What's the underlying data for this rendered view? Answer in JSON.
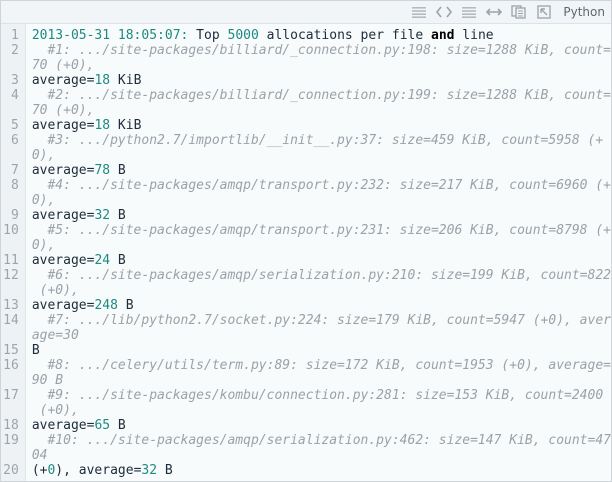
{
  "toolbar": {
    "icons": [
      "view-source-icon",
      "expand-icon",
      "copy-icon",
      "print-icon",
      "popout-icon"
    ],
    "language": "Python"
  },
  "code": {
    "line_numbers": [
      "1",
      "2",
      "3",
      "4",
      "5",
      "6",
      "7",
      "8",
      "9",
      "10",
      "11",
      "12",
      "13",
      "14",
      "15",
      "16",
      "17",
      "18",
      "19",
      "20"
    ],
    "rows": [
      {
        "kind": "header",
        "ts": "2013-05-31 18:05:07:",
        "t1": " Top ",
        "n": "5000",
        "t2": " allocations per file ",
        "kw": "and",
        "t3": " line"
      },
      {
        "kind": "comment",
        "text": "  #1: .../site-packages/billiard/_connection.py:198: size=1288 KiB, count="
      },
      {
        "kind": "comment",
        "text": "70 (+0),"
      },
      {
        "kind": "avg",
        "label": "average=",
        "value": "18",
        "unit": " KiB"
      },
      {
        "kind": "comment",
        "text": "  #2: .../site-packages/billiard/_connection.py:199: size=1288 KiB, count="
      },
      {
        "kind": "comment",
        "text": "70 (+0),"
      },
      {
        "kind": "avg",
        "label": "average=",
        "value": "18",
        "unit": " KiB"
      },
      {
        "kind": "comment",
        "text": "  #3: .../python2.7/importlib/__init__.py:37: size=459 KiB, count=5958 (+"
      },
      {
        "kind": "comment",
        "text": "0),"
      },
      {
        "kind": "avg",
        "label": "average=",
        "value": "78",
        "unit": " B"
      },
      {
        "kind": "comment",
        "text": "  #4: .../site-packages/amqp/transport.py:232: size=217 KiB, count=6960 (+"
      },
      {
        "kind": "comment",
        "text": "0),"
      },
      {
        "kind": "avg",
        "label": "average=",
        "value": "32",
        "unit": " B"
      },
      {
        "kind": "comment",
        "text": "  #5: .../site-packages/amqp/transport.py:231: size=206 KiB, count=8798 (+"
      },
      {
        "kind": "comment",
        "text": "0),"
      },
      {
        "kind": "avg",
        "label": "average=",
        "value": "24",
        "unit": " B"
      },
      {
        "kind": "comment",
        "text": "  #6: .../site-packages/amqp/serialization.py:210: size=199 KiB, count=822"
      },
      {
        "kind": "comment",
        "text": " (+0),"
      },
      {
        "kind": "avg",
        "label": "average=",
        "value": "248",
        "unit": " B"
      },
      {
        "kind": "comment",
        "text": "  #7: .../lib/python2.7/socket.py:224: size=179 KiB, count=5947 (+0), aver"
      },
      {
        "kind": "comment",
        "text": "age=30"
      },
      {
        "kind": "plain",
        "text": "B"
      },
      {
        "kind": "comment",
        "text": "  #8: .../celery/utils/term.py:89: size=172 KiB, count=1953 (+0), average="
      },
      {
        "kind": "comment",
        "text": "90 B"
      },
      {
        "kind": "comment",
        "text": "  #9: .../site-packages/kombu/connection.py:281: size=153 KiB, count=2400"
      },
      {
        "kind": "comment",
        "text": " (+0),"
      },
      {
        "kind": "avg",
        "label": "average=",
        "value": "65",
        "unit": " B"
      },
      {
        "kind": "comment",
        "text": "  #10: .../site-packages/amqp/serialization.py:462: size=147 KiB, count=47"
      },
      {
        "kind": "comment",
        "text": "04"
      },
      {
        "kind": "tail",
        "text1": "(+",
        "value1": "0",
        "text2": "), average=",
        "value2": "32",
        "unit": " B"
      }
    ]
  }
}
